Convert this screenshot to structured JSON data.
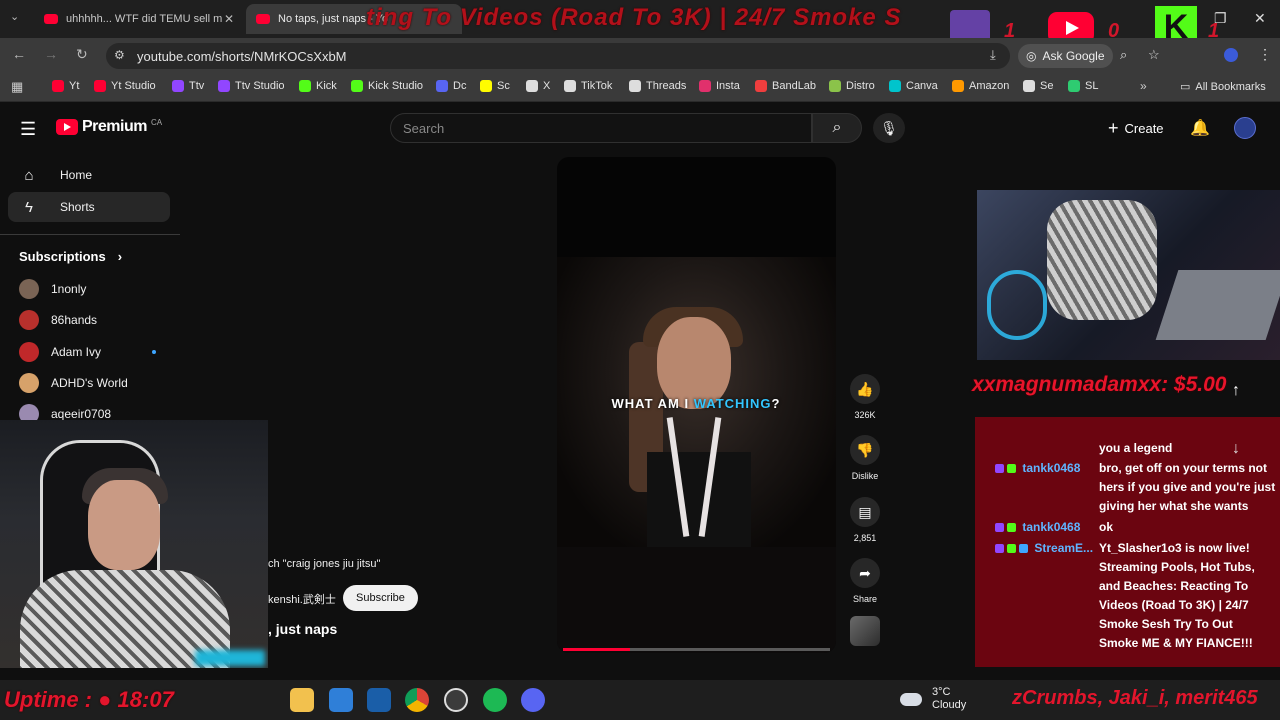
{
  "tabs": [
    {
      "label": "uhhhhh... WTF did TEMU sell m"
    },
    {
      "label": "No taps, just naps - Yo"
    }
  ],
  "stream_title_overlay": "ting To Videos (Road To 3K) | 24/7 Smoke S",
  "address": {
    "url": "youtube.com/shorts/NMrKOCsXxbM",
    "ask_google": "Ask Google"
  },
  "bookmarks": [
    {
      "label": "Yt",
      "color": "#ff0033"
    },
    {
      "label": "Yt Studio",
      "color": "#ff0033"
    },
    {
      "label": "Ttv",
      "color": "#9146ff"
    },
    {
      "label": "Ttv Studio",
      "color": "#9146ff"
    },
    {
      "label": "Kick",
      "color": "#53fc18"
    },
    {
      "label": "Kick Studio",
      "color": "#53fc18"
    },
    {
      "label": "Dc",
      "color": "#5865f2"
    },
    {
      "label": "Sc",
      "color": "#fffc00"
    },
    {
      "label": "X",
      "color": "#dddddd"
    },
    {
      "label": "TikTok",
      "color": "#dddddd"
    },
    {
      "label": "Threads",
      "color": "#dddddd"
    },
    {
      "label": "Insta",
      "color": "#e1306c"
    },
    {
      "label": "BandLab",
      "color": "#f03e3e"
    },
    {
      "label": "Distro",
      "color": "#8bc34a"
    },
    {
      "label": "Canva",
      "color": "#00c4cc"
    },
    {
      "label": "Amazon",
      "color": "#ff9900"
    },
    {
      "label": "Se",
      "color": "#dddddd"
    },
    {
      "label": "SL",
      "color": "#2ecc71"
    }
  ],
  "all_bookmarks": "All Bookmarks",
  "youtube": {
    "logo": "Premium",
    "region": "CA",
    "search_placeholder": "Search",
    "create": "Create"
  },
  "sidebar": {
    "home": "Home",
    "shorts": "Shorts",
    "subscriptions": "Subscriptions",
    "channels": [
      {
        "name": "1nonly",
        "color": "#7a6455"
      },
      {
        "name": "86hands",
        "color": "#b8302c"
      },
      {
        "name": "Adam Ivy",
        "color": "#c0282a"
      },
      {
        "name": "ADHD's World",
        "color": "#d7a26a"
      },
      {
        "name": "aqeeir0708",
        "color": "#9a8ab0"
      }
    ]
  },
  "short": {
    "search_chip": "ch \"craig jones jiu jitsu\"",
    "channel": "kenshi.武剣士",
    "subscribe": "Subscribe",
    "title": ", just naps",
    "caption_a": "WHAT AM I",
    "caption_b": "WATCHING",
    "caption_c": "?",
    "progress": 0.25
  },
  "actions": {
    "likes": "326K",
    "dislike": "Dislike",
    "comments": "2,851",
    "share": "Share"
  },
  "stream": {
    "donation": "xxmagnumadamxx: $5.00",
    "chat": [
      {
        "kind": "text",
        "text": "you a legend"
      },
      {
        "kind": "msg",
        "user": "tankk0468",
        "text": "bro, get off on your terms not"
      },
      {
        "kind": "text",
        "text": "hers if you give and you're just"
      },
      {
        "kind": "text",
        "text": "giving her what she wants"
      },
      {
        "kind": "msg",
        "user": "tankk0468",
        "text": "ok"
      },
      {
        "kind": "msg",
        "user": "StreamE...",
        "text": "Yt_Slasher1o3 is now live!"
      },
      {
        "kind": "text",
        "text": "Streaming Pools, Hot Tubs,"
      },
      {
        "kind": "text",
        "text": "and Beaches: Reacting To"
      },
      {
        "kind": "text",
        "text": "Videos (Road To 3K) | 24/7"
      },
      {
        "kind": "text",
        "text": "Smoke Sesh Try To Out"
      },
      {
        "kind": "text",
        "text": "Smoke ME & MY FIANCE!!!"
      }
    ],
    "uptime": "Uptime : ",
    "uptime_value": "18:07",
    "ticker": "zCrumbs, Jaki_i, merit465",
    "kick_letter": "K",
    "yt_count": "0",
    "kick_count": "1",
    "twitch_count": "1"
  },
  "weather": {
    "temp": "3°C",
    "cond": "Cloudy"
  }
}
